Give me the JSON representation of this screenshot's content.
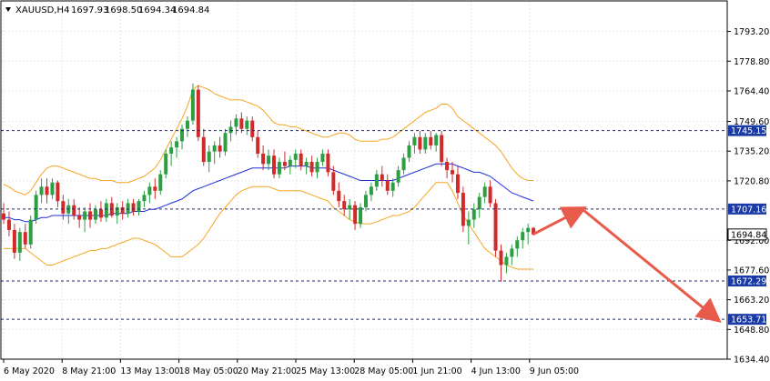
{
  "colors": {
    "bullish": "#2e9e43",
    "bearish": "#d12a2a",
    "bands": "#f5a623",
    "ma": "#1f2fd6",
    "level_line": "#1a2a8a",
    "level_box": "#1a3aa6",
    "price_box": "#ffffff",
    "arrow": "#e85a4a",
    "grid": "#e6e6ef"
  },
  "header": {
    "symbol": "XAUUSD,H4",
    "open": "1697.93",
    "high": "1698.50",
    "low": "1694.34",
    "close": "1694.84"
  },
  "chart_data": {
    "type": "candlestick",
    "ylim": [
      1634.4,
      1808.0
    ],
    "grid": true,
    "y_ticks": [
      "1793.20",
      "1778.80",
      "1764.40",
      "1749.60",
      "1735.20",
      "1720.80",
      "1692.00",
      "1677.60",
      "1663.20",
      "1648.80",
      "1634.40"
    ],
    "x_ticks": [
      "6 May 2020",
      "8 May 21:00",
      "13 May 13:00",
      "18 May 05:00",
      "20 May 21:00",
      "25 May 13:00",
      "28 May 05:00",
      "1 Jun 21:00",
      "4 Jun 13:00",
      "9 Jun 05:00"
    ],
    "levels": [
      {
        "label": "1745.15",
        "value": 1745.15
      },
      {
        "label": "1707.16",
        "value": 1707.16
      },
      {
        "label": "1672.29",
        "value": 1672.29
      },
      {
        "label": "1653.71",
        "value": 1653.71
      }
    ],
    "current_price": {
      "label": "1694.84",
      "value": 1694.84
    },
    "candles": [
      [
        1705.0,
        1710.0,
        1700.0,
        1702.0
      ],
      [
        1702.0,
        1706.0,
        1694.0,
        1697.0
      ],
      [
        1697.0,
        1700.0,
        1683.0,
        1686.0
      ],
      [
        1686.0,
        1698.0,
        1682.0,
        1696.0
      ],
      [
        1696.0,
        1700.0,
        1688.0,
        1690.0
      ],
      [
        1690.0,
        1704.0,
        1688.0,
        1702.0
      ],
      [
        1702.0,
        1716.0,
        1700.0,
        1714.0
      ],
      [
        1714.0,
        1722.0,
        1710.0,
        1718.0
      ],
      [
        1718.0,
        1722.0,
        1710.0,
        1714.0
      ],
      [
        1714.0,
        1722.0,
        1712.0,
        1720.0
      ],
      [
        1720.0,
        1721.0,
        1708.0,
        1711.0
      ],
      [
        1711.0,
        1714.0,
        1702.0,
        1705.0
      ],
      [
        1705.0,
        1712.0,
        1700.0,
        1709.0
      ],
      [
        1709.0,
        1712.0,
        1702.0,
        1704.0
      ],
      [
        1704.0,
        1708.0,
        1698.0,
        1702.0
      ],
      [
        1702.0,
        1708.0,
        1696.0,
        1706.0
      ],
      [
        1706.0,
        1710.0,
        1698.0,
        1702.0
      ],
      [
        1702.0,
        1709.0,
        1700.0,
        1707.0
      ],
      [
        1707.0,
        1711.0,
        1701.0,
        1703.0
      ],
      [
        1703.0,
        1712.0,
        1701.0,
        1710.0
      ],
      [
        1710.0,
        1713.0,
        1703.0,
        1704.0
      ],
      [
        1704.0,
        1710.0,
        1700.0,
        1708.0
      ],
      [
        1708.0,
        1711.0,
        1702.0,
        1705.0
      ],
      [
        1705.0,
        1712.0,
        1703.0,
        1710.0
      ],
      [
        1710.0,
        1712.0,
        1704.0,
        1706.0
      ],
      [
        1706.0,
        1712.0,
        1704.0,
        1711.0
      ],
      [
        1711.0,
        1716.0,
        1708.0,
        1714.0
      ],
      [
        1714.0,
        1720.0,
        1710.0,
        1718.0
      ],
      [
        1718.0,
        1722.0,
        1712.0,
        1716.0
      ],
      [
        1716.0,
        1726.0,
        1714.0,
        1724.0
      ],
      [
        1724.0,
        1736.0,
        1722.0,
        1734.0
      ],
      [
        1734.0,
        1740.0,
        1728.0,
        1737.0
      ],
      [
        1737.0,
        1742.0,
        1732.0,
        1740.0
      ],
      [
        1740.0,
        1748.0,
        1736.0,
        1746.0
      ],
      [
        1746.0,
        1752.0,
        1742.0,
        1750.0
      ],
      [
        1750.0,
        1768.0,
        1748.0,
        1765.0
      ],
      [
        1765.0,
        1767.0,
        1740.0,
        1742.0
      ],
      [
        1742.0,
        1746.0,
        1728.0,
        1730.0
      ],
      [
        1730.0,
        1738.0,
        1725.0,
        1735.0
      ],
      [
        1735.0,
        1740.0,
        1729.0,
        1738.0
      ],
      [
        1738.0,
        1742.0,
        1732.0,
        1735.0
      ],
      [
        1735.0,
        1746.0,
        1733.0,
        1744.0
      ],
      [
        1744.0,
        1750.0,
        1740.0,
        1747.0
      ],
      [
        1747.0,
        1753.0,
        1743.0,
        1751.0
      ],
      [
        1751.0,
        1754.0,
        1744.0,
        1746.0
      ],
      [
        1746.0,
        1752.0,
        1743.0,
        1750.0
      ],
      [
        1750.0,
        1752.0,
        1740.0,
        1742.0
      ],
      [
        1742.0,
        1745.0,
        1732.0,
        1734.0
      ],
      [
        1734.0,
        1738.0,
        1726.0,
        1729.0
      ],
      [
        1729.0,
        1736.0,
        1726.0,
        1733.0
      ],
      [
        1733.0,
        1736.0,
        1722.0,
        1724.0
      ],
      [
        1724.0,
        1732.0,
        1722.0,
        1730.0
      ],
      [
        1730.0,
        1735.0,
        1726.0,
        1728.0
      ],
      [
        1728.0,
        1733.0,
        1724.0,
        1731.0
      ],
      [
        1731.0,
        1736.0,
        1727.0,
        1734.0
      ],
      [
        1734.0,
        1736.0,
        1726.0,
        1728.0
      ],
      [
        1728.0,
        1732.0,
        1724.0,
        1730.0
      ],
      [
        1730.0,
        1733.0,
        1723.0,
        1725.0
      ],
      [
        1725.0,
        1732.0,
        1722.0,
        1730.0
      ],
      [
        1730.0,
        1736.0,
        1728.0,
        1734.0
      ],
      [
        1734.0,
        1736.0,
        1723.0,
        1725.0
      ],
      [
        1725.0,
        1728.0,
        1714.0,
        1716.0
      ],
      [
        1716.0,
        1720.0,
        1708.0,
        1711.0
      ],
      [
        1711.0,
        1714.0,
        1704.0,
        1707.0
      ],
      [
        1707.0,
        1712.0,
        1702.0,
        1709.0
      ],
      [
        1709.0,
        1711.0,
        1697.0,
        1700.0
      ],
      [
        1700.0,
        1710.0,
        1698.0,
        1708.0
      ],
      [
        1708.0,
        1716.0,
        1706.0,
        1714.0
      ],
      [
        1714.0,
        1720.0,
        1711.0,
        1718.0
      ],
      [
        1718.0,
        1726.0,
        1716.0,
        1724.0
      ],
      [
        1724.0,
        1728.0,
        1718.0,
        1721.0
      ],
      [
        1721.0,
        1724.0,
        1714.0,
        1716.0
      ],
      [
        1716.0,
        1722.0,
        1713.0,
        1720.0
      ],
      [
        1720.0,
        1728.0,
        1718.0,
        1726.0
      ],
      [
        1726.0,
        1734.0,
        1724.0,
        1732.0
      ],
      [
        1732.0,
        1740.0,
        1730.0,
        1738.0
      ],
      [
        1738.0,
        1744.0,
        1734.0,
        1742.0
      ],
      [
        1742.0,
        1745.0,
        1734.0,
        1736.0
      ],
      [
        1736.0,
        1744.0,
        1734.0,
        1742.0
      ],
      [
        1742.0,
        1745.0,
        1736.0,
        1738.0
      ],
      [
        1738.0,
        1744.0,
        1735.0,
        1743.0
      ],
      [
        1743.0,
        1745.0,
        1728.0,
        1730.0
      ],
      [
        1730.0,
        1732.0,
        1722.0,
        1726.0
      ],
      [
        1726.0,
        1730.0,
        1720.0,
        1724.0
      ],
      [
        1724.0,
        1728.0,
        1712.0,
        1715.0
      ],
      [
        1715.0,
        1718.0,
        1696.0,
        1699.0
      ],
      [
        1699.0,
        1706.0,
        1690.0,
        1702.0
      ],
      [
        1702.0,
        1710.0,
        1698.0,
        1707.0
      ],
      [
        1707.0,
        1715.0,
        1703.0,
        1713.0
      ],
      [
        1713.0,
        1720.0,
        1710.0,
        1718.0
      ],
      [
        1718.0,
        1721.0,
        1708.0,
        1710.0
      ],
      [
        1710.0,
        1712.0,
        1684.0,
        1687.0
      ],
      [
        1687.0,
        1690.0,
        1672.0,
        1680.0
      ],
      [
        1680.0,
        1686.0,
        1676.0,
        1684.0
      ],
      [
        1684.0,
        1690.0,
        1680.0,
        1688.0
      ],
      [
        1688.0,
        1694.0,
        1684.0,
        1692.0
      ],
      [
        1692.0,
        1698.0,
        1688.0,
        1696.0
      ],
      [
        1696.0,
        1700.0,
        1690.0,
        1698.0
      ],
      [
        1698.0,
        1698.5,
        1694.34,
        1694.84
      ]
    ],
    "moving_average": [
      1703,
      1703,
      1702,
      1702,
      1701,
      1701,
      1702,
      1703,
      1703,
      1704,
      1704,
      1704,
      1704,
      1704,
      1704,
      1704,
      1704,
      1704,
      1704,
      1704,
      1705,
      1705,
      1705,
      1705,
      1706,
      1706,
      1706,
      1707,
      1707,
      1708,
      1709,
      1710,
      1711,
      1712,
      1714,
      1716,
      1717,
      1718,
      1719,
      1720,
      1721,
      1722,
      1723,
      1724,
      1725,
      1726,
      1727,
      1727,
      1727,
      1727,
      1727,
      1727,
      1727,
      1728,
      1728,
      1728,
      1728,
      1727,
      1727,
      1727,
      1727,
      1726,
      1725,
      1724,
      1723,
      1722,
      1721,
      1721,
      1721,
      1721,
      1721,
      1721,
      1721,
      1722,
      1723,
      1724,
      1725,
      1726,
      1727,
      1728,
      1729,
      1729,
      1729,
      1729,
      1728,
      1727,
      1726,
      1725,
      1725,
      1724,
      1723,
      1721,
      1719,
      1717,
      1715,
      1714,
      1713,
      1712,
      1711
    ],
    "band_upper": [
      1719,
      1718,
      1716,
      1715,
      1714,
      1716,
      1720,
      1724,
      1727,
      1728,
      1728,
      1727,
      1726,
      1725,
      1724,
      1723,
      1722,
      1722,
      1721,
      1721,
      1721,
      1720,
      1720,
      1720,
      1721,
      1722,
      1723,
      1725,
      1727,
      1731,
      1736,
      1741,
      1746,
      1751,
      1757,
      1765,
      1767,
      1766,
      1765,
      1763,
      1762,
      1761,
      1760,
      1760,
      1760,
      1759,
      1758,
      1757,
      1755,
      1752,
      1749,
      1748,
      1748,
      1747,
      1747,
      1746,
      1745,
      1744,
      1743,
      1742,
      1742,
      1743,
      1744,
      1744,
      1743,
      1741,
      1740,
      1740,
      1740,
      1740,
      1741,
      1741,
      1742,
      1744,
      1746,
      1748,
      1750,
      1752,
      1754,
      1755,
      1756,
      1758,
      1758,
      1756,
      1752,
      1750,
      1748,
      1746,
      1744,
      1742,
      1740,
      1738,
      1735,
      1731,
      1727,
      1724,
      1722,
      1721,
      1721
    ],
    "band_lower": [
      1688,
      1688,
      1688,
      1688,
      1688,
      1686,
      1684,
      1682,
      1680,
      1680,
      1681,
      1682,
      1683,
      1684,
      1685,
      1686,
      1687,
      1687,
      1688,
      1688,
      1689,
      1690,
      1691,
      1692,
      1693,
      1693,
      1692,
      1691,
      1690,
      1688,
      1686,
      1684,
      1684,
      1684,
      1686,
      1688,
      1690,
      1693,
      1697,
      1701,
      1705,
      1708,
      1711,
      1714,
      1716,
      1717,
      1718,
      1718,
      1718,
      1718,
      1717,
      1716,
      1716,
      1716,
      1716,
      1716,
      1715,
      1714,
      1713,
      1712,
      1711,
      1708,
      1706,
      1704,
      1702,
      1701,
      1700,
      1700,
      1700,
      1701,
      1702,
      1703,
      1704,
      1704,
      1705,
      1706,
      1708,
      1711,
      1714,
      1717,
      1720,
      1720,
      1720,
      1716,
      1710,
      1704,
      1700,
      1696,
      1692,
      1688,
      1686,
      1684,
      1682,
      1680,
      1679,
      1678,
      1678,
      1678,
      1678
    ]
  },
  "annotations": {
    "arrows": [
      {
        "from": {
          "x": 98,
          "value": 1695.0
        },
        "to": {
          "x": 107,
          "value": 1707.16
        }
      },
      {
        "from": {
          "x": 107,
          "value": 1707.16
        },
        "to": {
          "x": 132,
          "value": 1653.71
        }
      }
    ]
  }
}
